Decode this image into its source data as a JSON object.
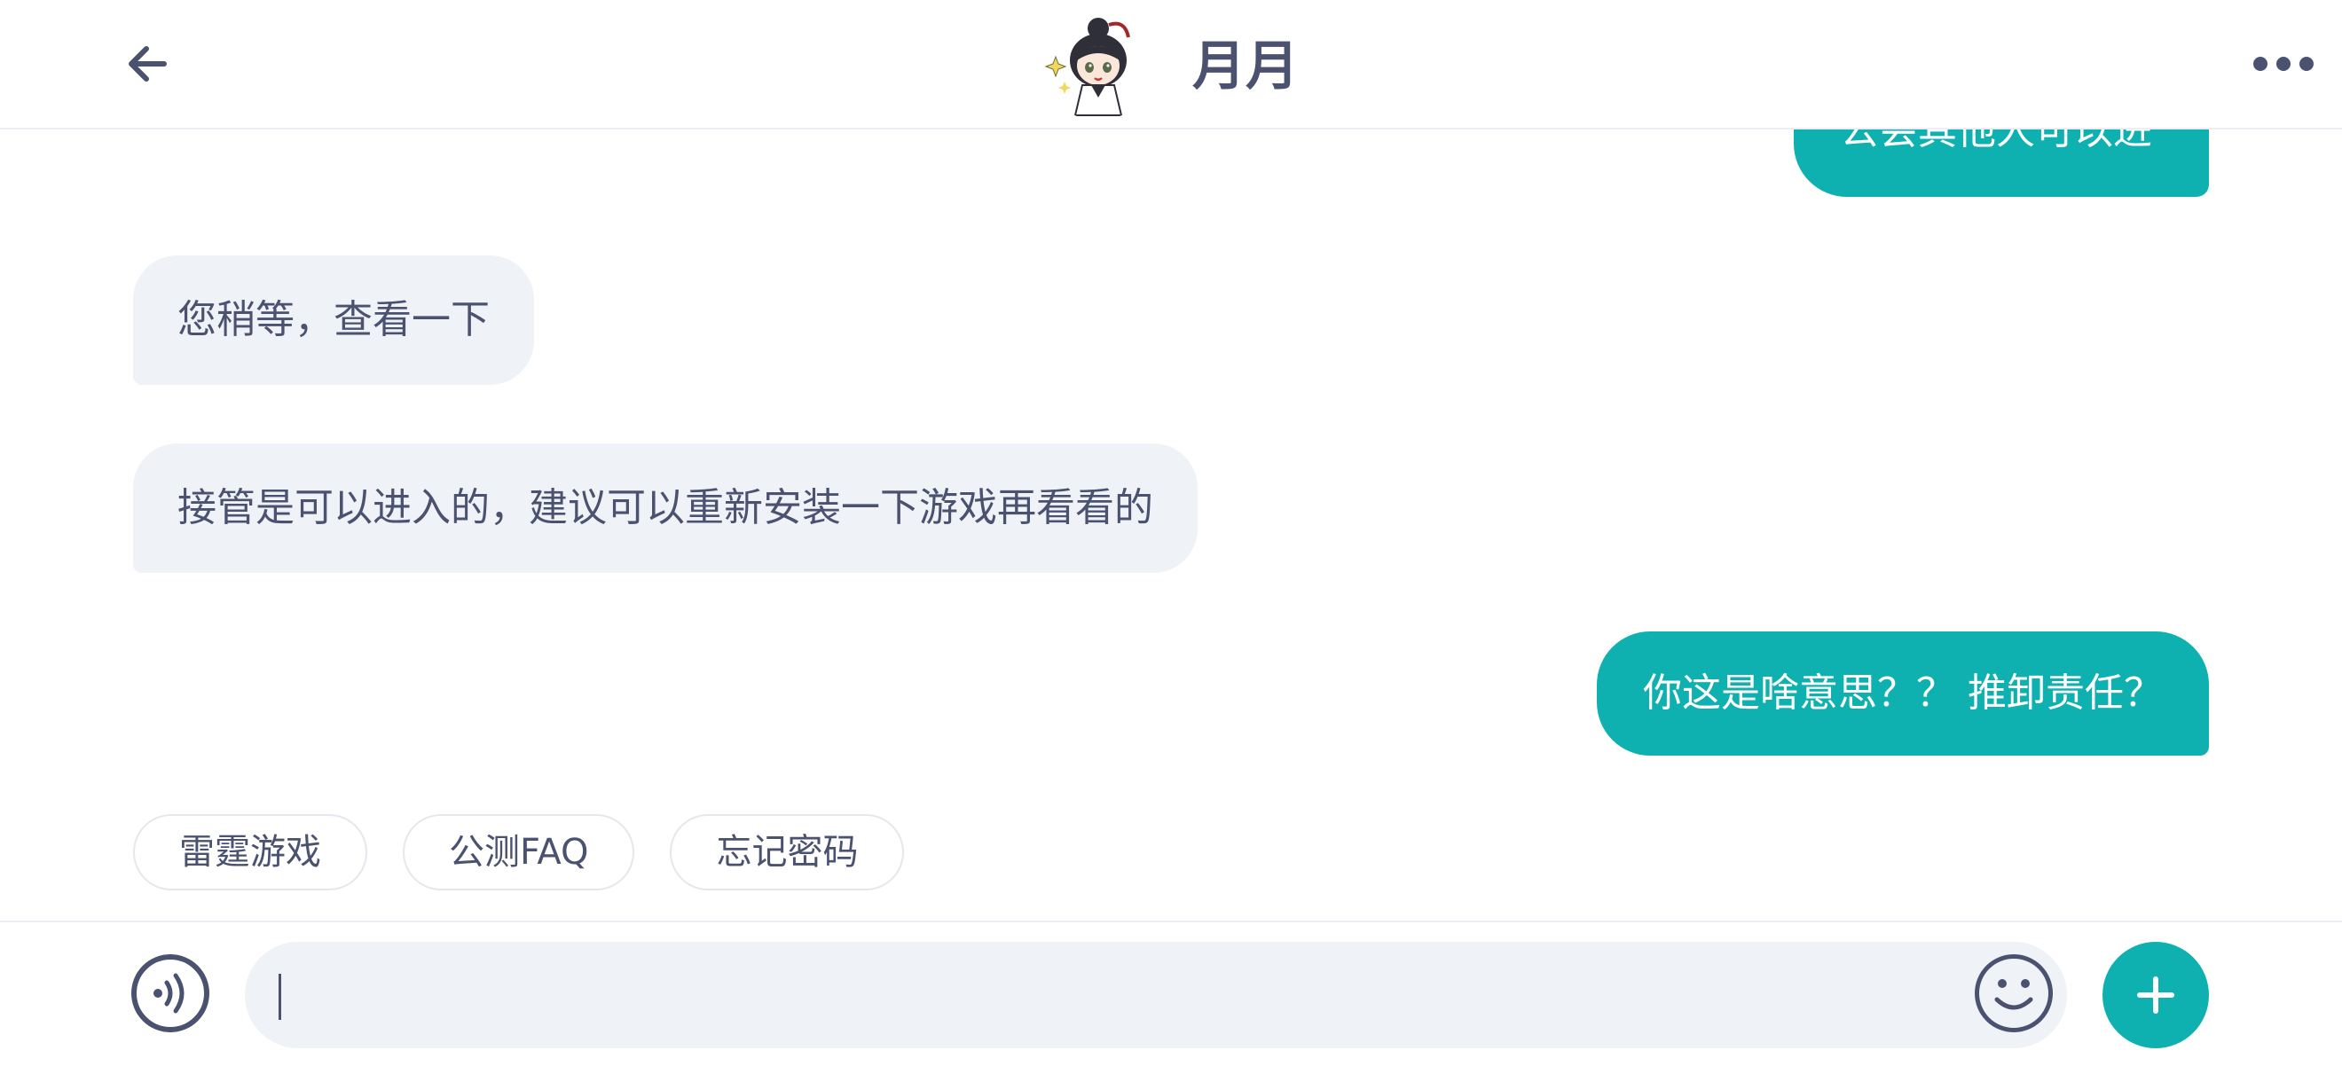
{
  "header": {
    "contact_name": "月月",
    "icons": {
      "back": "arrow-left-icon",
      "more": "more-dots-icon",
      "avatar": "anime-girl-avatar"
    }
  },
  "messages": [
    {
      "side": "out",
      "text": "公会其他人可以进",
      "partial": true
    },
    {
      "side": "in",
      "text": "您稍等，查看一下"
    },
    {
      "side": "in",
      "text": "接管是可以进入的，建议可以重新安装一下游戏再看看的"
    },
    {
      "side": "out",
      "text": "你这是啥意思？？ 推卸责任？"
    }
  ],
  "quick_replies": [
    "雷霆游戏",
    "公测FAQ",
    "忘记密码"
  ],
  "input": {
    "value": "",
    "placeholder": "",
    "icons": {
      "voice": "voice-icon",
      "emoji": "emoji-icon",
      "add": "plus-icon"
    }
  },
  "colors": {
    "accent": "#0eb1b0",
    "text": "#4a5270",
    "incoming_bubble": "#eff2f6"
  }
}
